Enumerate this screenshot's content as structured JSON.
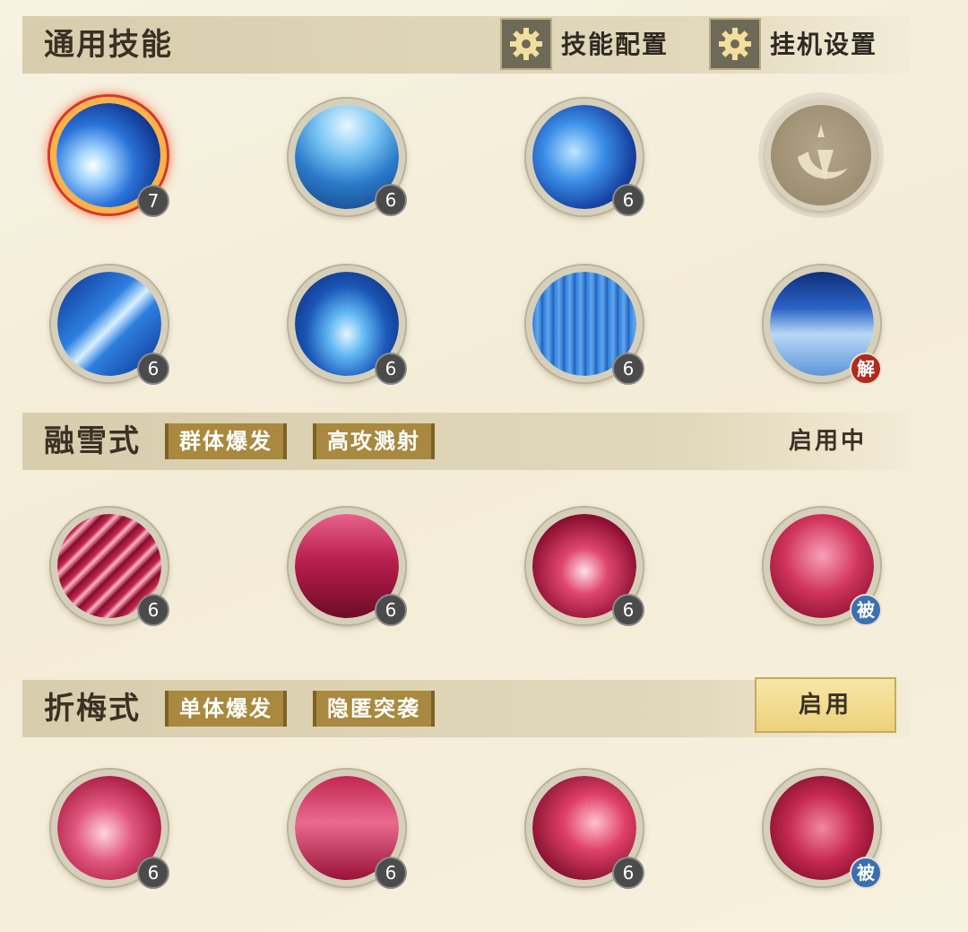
{
  "general": {
    "title": "通用技能",
    "skill_config_label": "技能配置",
    "idle_settings_label": "挂机设置"
  },
  "rongxue": {
    "title": "融雪式",
    "tags": [
      "群体爆发",
      "高攻溅射"
    ],
    "status": "启用中"
  },
  "zhemei": {
    "title": "折梅式",
    "tags": [
      "单体爆发",
      "隐匿突袭"
    ],
    "enable_label": "启用"
  },
  "rows": [
    {
      "levels": [
        "7",
        "6",
        "6",
        ""
      ]
    },
    {
      "levels": [
        "6",
        "6",
        "6",
        ""
      ],
      "marker": "解"
    },
    {
      "levels": [
        "6",
        "6",
        "6",
        ""
      ],
      "marker": "被"
    },
    {
      "levels": [
        "6",
        "6",
        "6",
        ""
      ],
      "marker": "被"
    }
  ],
  "colors": {
    "bar": "#d6cba9",
    "tag": "#a8893f",
    "blue_skill": "#1f5fc7",
    "red_skill": "#c2234a",
    "level_badge": "#4b4b4b"
  },
  "icons": {
    "gear": "gear-icon",
    "locked_slot": "crescent-emblem-icon"
  }
}
